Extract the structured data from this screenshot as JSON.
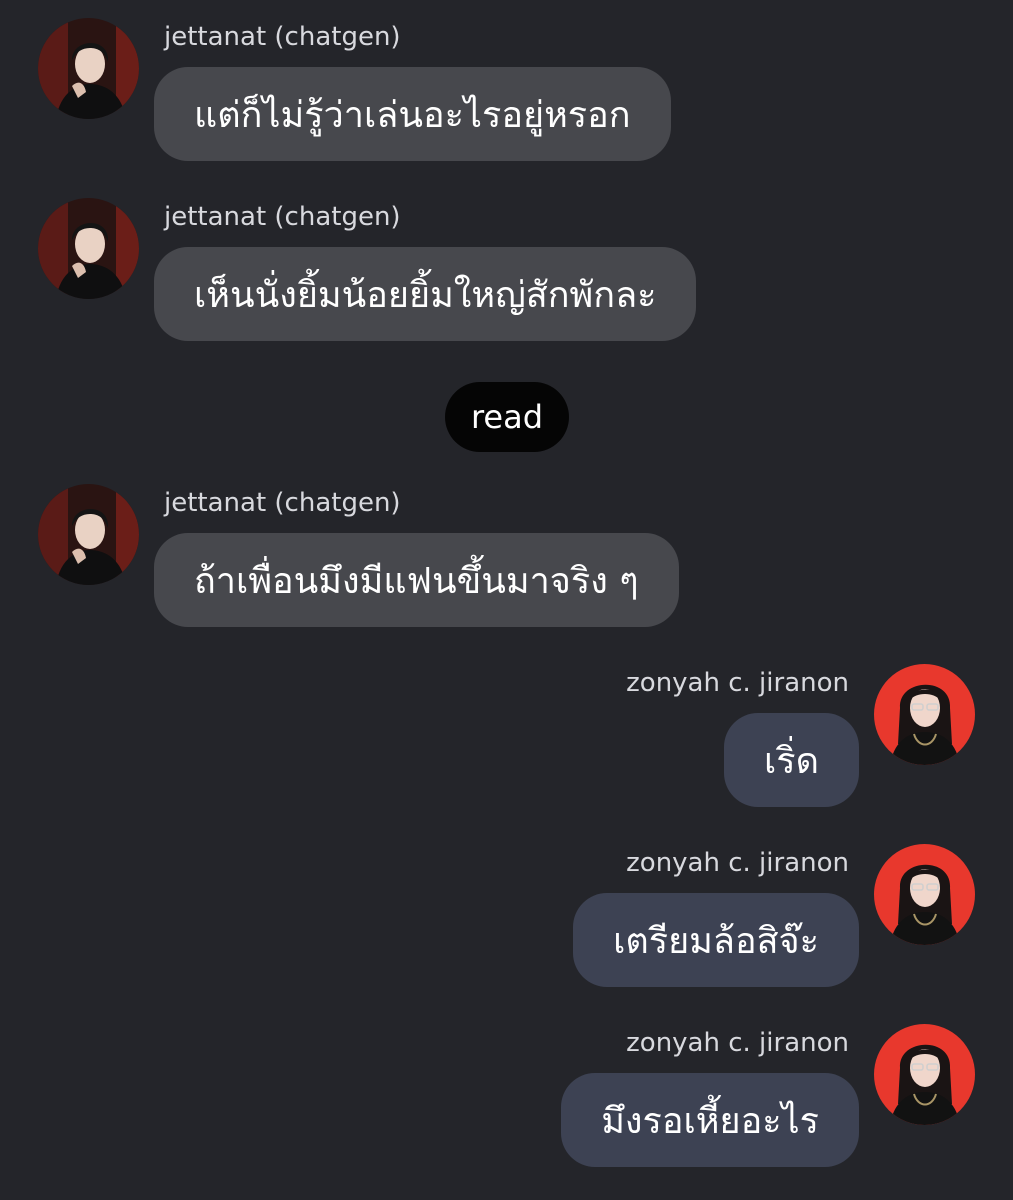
{
  "messages": [
    {
      "side": "left",
      "sender": "jettanat (chatgen)",
      "avatar": "avatar-jettanat",
      "text": "แต่ก็ไม่รู้ว่าเล่นอะไรอยู่หรอก"
    },
    {
      "side": "left",
      "sender": "jettanat (chatgen)",
      "avatar": "avatar-jettanat",
      "text": "เห็นนั่งยิ้มน้อยยิ้มใหญ่สักพักละ"
    },
    {
      "side": "left",
      "sender": "jettanat (chatgen)",
      "avatar": "avatar-jettanat",
      "text": "ถ้าเพื่อนมึงมีแฟนขึ้นมาจริง ๆ"
    },
    {
      "side": "right",
      "sender": "zonyah c. jiranon",
      "avatar": "avatar-zonyah",
      "text": "เริ่ด"
    },
    {
      "side": "right",
      "sender": "zonyah c. jiranon",
      "avatar": "avatar-zonyah",
      "text": "เตรียมล้อสิจ๊ะ"
    },
    {
      "side": "right",
      "sender": "zonyah c. jiranon",
      "avatar": "avatar-zonyah",
      "text": "มึงรอเหี้ยอะไร"
    }
  ],
  "read_receipt": "read",
  "colors": {
    "background": "#24252a",
    "incoming_bubble": "#47484d",
    "outgoing_bubble": "#3d4253",
    "read_pill": "#050505",
    "zonyah_avatar_bg": "#e8382d"
  }
}
